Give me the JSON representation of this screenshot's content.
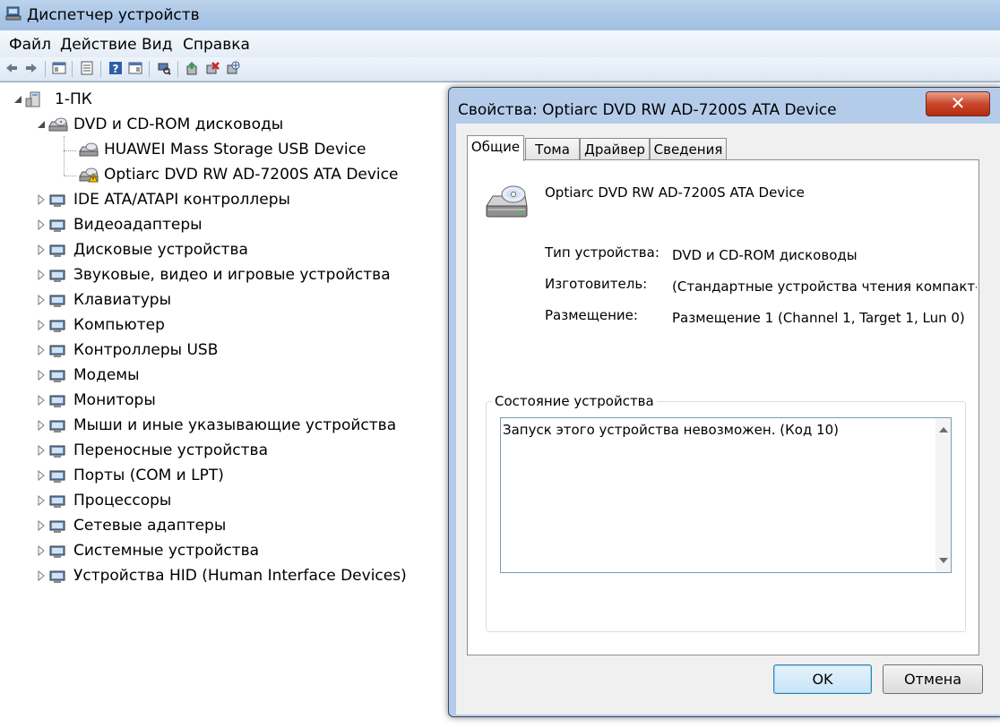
{
  "window": {
    "title": "Диспетчер устройств"
  },
  "menu": [
    "Файл",
    "Действие",
    "Вид",
    "Справка"
  ],
  "toolbar": {
    "icons": [
      "back-icon",
      "forward-icon",
      "show-hide-tree-icon",
      "properties-icon",
      "help-icon",
      "view-icon",
      "scan-hardware-icon",
      "update-driver-icon",
      "uninstall-icon",
      "disable-icon"
    ]
  },
  "tree": {
    "root": "1-ПК",
    "dvd_group": "DVD и CD-ROM дисководы",
    "dvd_children": [
      "HUAWEI Mass Storage USB Device",
      "Optiarc DVD RW AD-7200S ATA Device"
    ],
    "categories": [
      "IDE ATA/ATAPI контроллеры",
      "Видеоадаптеры",
      "Дисковые устройства",
      "Звуковые, видео и игровые устройства",
      "Клавиатуры",
      "Компьютер",
      "Контроллеры USB",
      "Модемы",
      "Мониторы",
      "Мыши и иные указывающие устройства",
      "Переносные устройства",
      "Порты (COM и LPT)",
      "Процессоры",
      "Сетевые адаптеры",
      "Системные устройства",
      "Устройства HID (Human Interface Devices)"
    ]
  },
  "dialog": {
    "title": "Свойства: Optiarc DVD RW AD-7200S ATA Device",
    "close_glyph": "✕",
    "tabs": [
      "Общие",
      "Тома",
      "Драйвер",
      "Сведения"
    ],
    "device_name": "Optiarc DVD RW AD-7200S ATA Device",
    "type_label": "Тип устройства:",
    "type_value": "DVD и CD-ROM дисководы",
    "maker_label": "Изготовитель:",
    "maker_value": "(Стандартные устройства чтения компакт-",
    "location_label": "Размещение:",
    "location_value": "Размещение 1 (Channel 1, Target 1, Lun 0)",
    "status_group": "Состояние устройства",
    "status_text": "Запуск этого устройства невозможен. (Код 10)",
    "ok": "OK",
    "cancel": "Отмена"
  }
}
